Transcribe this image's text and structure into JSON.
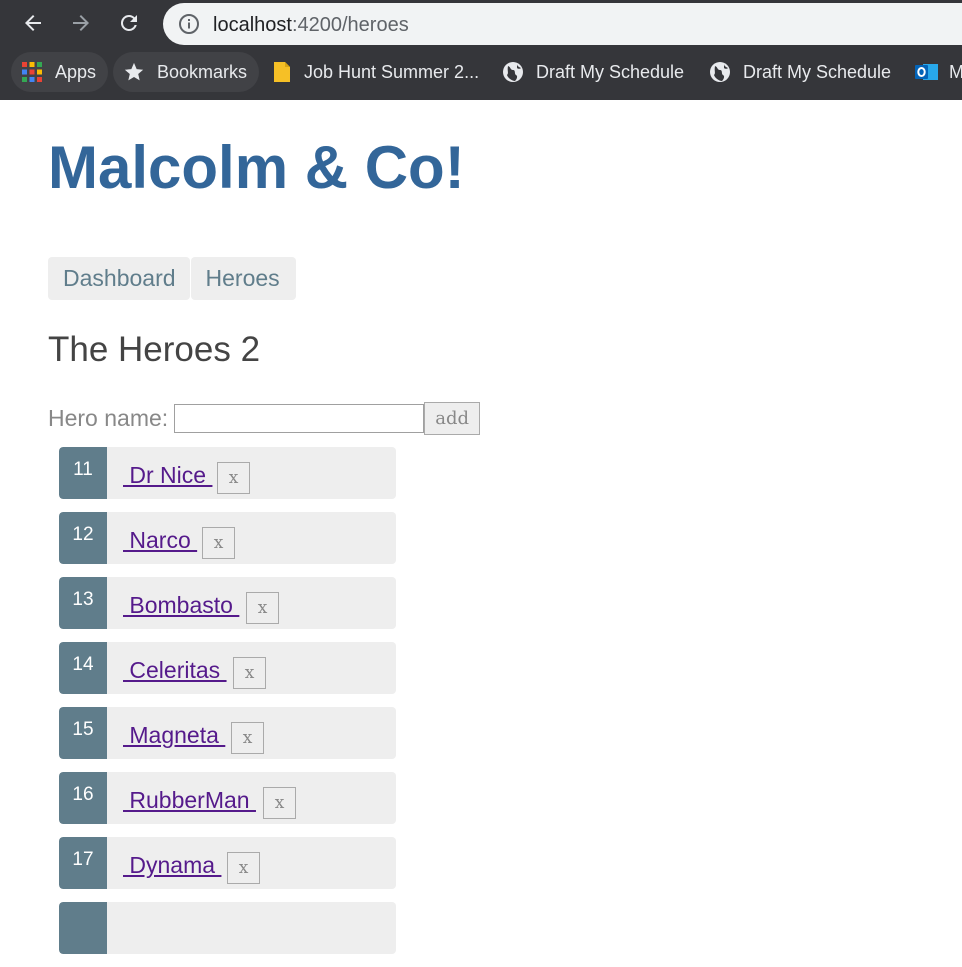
{
  "browser": {
    "url_host": "localhost",
    "url_path": ":4200/heroes",
    "bookmarks": [
      {
        "label": "Apps",
        "icon": "apps-grid-icon"
      },
      {
        "label": "Bookmarks",
        "icon": "star-icon"
      },
      {
        "label": "Job Hunt Summer 2...",
        "icon": "document-icon"
      },
      {
        "label": "Draft My Schedule",
        "icon": "globe-icon"
      },
      {
        "label": "Draft My Schedule",
        "icon": "globe-icon"
      },
      {
        "label": "M",
        "icon": "outlook-icon"
      }
    ]
  },
  "app": {
    "title": "Malcolm & Co!",
    "nav": [
      "Dashboard",
      "Heroes"
    ],
    "colors": {
      "title": "#336699",
      "badge": "#607d8b",
      "link": "#551a8b"
    }
  },
  "heroes": {
    "heading": "The Heroes 2",
    "name_label": "Hero name:",
    "name_value": "",
    "add_label": "add",
    "delete_label": "x",
    "list": [
      {
        "id": "11",
        "name": " Dr Nice "
      },
      {
        "id": "12",
        "name": " Narco "
      },
      {
        "id": "13",
        "name": " Bombasto "
      },
      {
        "id": "14",
        "name": " Celeritas "
      },
      {
        "id": "15",
        "name": " Magneta "
      },
      {
        "id": "16",
        "name": " RubberMan "
      },
      {
        "id": "17",
        "name": " Dynama "
      },
      {
        "id": "",
        "name": ""
      }
    ]
  }
}
